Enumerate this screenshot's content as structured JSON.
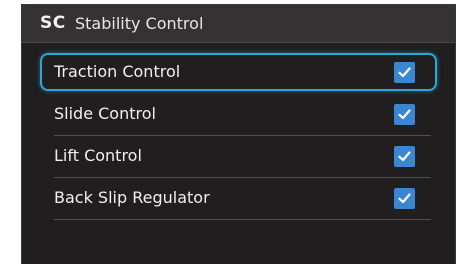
{
  "header": {
    "abbreviation": "SC",
    "title": "Stability Control"
  },
  "settings": [
    {
      "label": "Traction Control",
      "checked": true,
      "focused": true
    },
    {
      "label": "Slide Control",
      "checked": true,
      "focused": false
    },
    {
      "label": "Lift Control",
      "checked": true,
      "focused": false
    },
    {
      "label": "Back Slip Regulator",
      "checked": true,
      "focused": false
    }
  ],
  "icons": {
    "checkbox": "checkmark-icon"
  },
  "colors": {
    "background": "#201e1e",
    "header_background": "#343232",
    "focus_outline": "#2fa6d8",
    "checkbox_fill": "#3b86d1",
    "text": "#f0f0f0"
  }
}
